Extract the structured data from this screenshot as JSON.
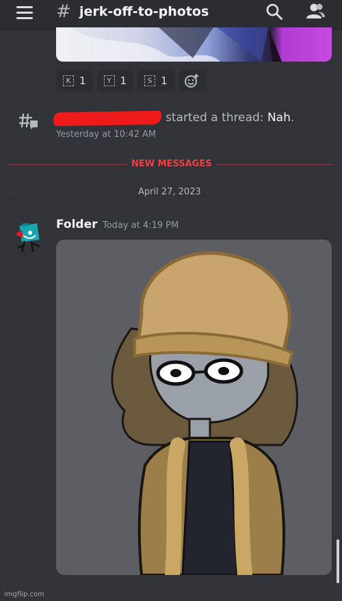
{
  "header": {
    "hash": "#",
    "channel_name": "jerk-off-to-photos",
    "icons": [
      "menu-icon",
      "search-icon",
      "members-icon"
    ]
  },
  "reactions": [
    {
      "emoji": "K",
      "count": "1"
    },
    {
      "emoji": "Y",
      "count": "1"
    },
    {
      "emoji": "S",
      "count": "1"
    }
  ],
  "thread_notice": {
    "text_before": "started a thread: ",
    "thread_name": "Nah",
    "text_after": ".",
    "timestamp": "Yesterday at 10:42 AM"
  },
  "dividers": {
    "new_messages": "NEW MESSAGES",
    "date": "April 27, 2023"
  },
  "message": {
    "author": "Folder",
    "timestamp": "Today at 4:19 PM"
  },
  "watermark": "imgflip.com",
  "colors": {
    "background": "#313338",
    "header": "#2b2d31",
    "new_messages": "#f23f43",
    "redaction": "#ef1a1a"
  }
}
